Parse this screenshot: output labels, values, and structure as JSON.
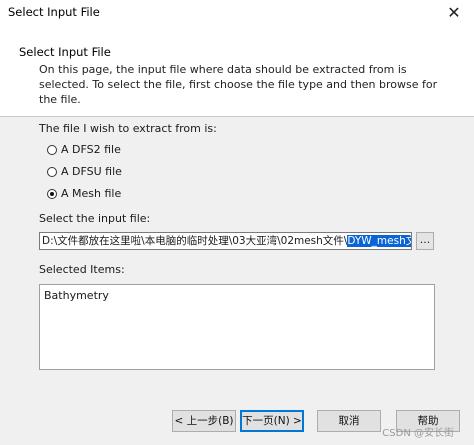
{
  "window": {
    "title": "Select Input File",
    "close_glyph": "✕"
  },
  "header": {
    "title": "Select Input File",
    "description": "On this page, the input file where data should be extracted from is selected. To select the file, first choose the file type and then browse for the file."
  },
  "extract": {
    "label": "The file I wish to extract from is:",
    "options": [
      {
        "label": "A DFS2 file",
        "selected": false
      },
      {
        "label": "A DFSU file",
        "selected": false
      },
      {
        "label": "A Mesh file",
        "selected": true
      }
    ]
  },
  "input_file": {
    "label": "Select the input file:",
    "path_prefix": "D:\\文件都放在这里啦\\本电脑的临时处理\\03大亚湾\\02mesh文件\\",
    "path_selected": "DYW_mesh文件.mesh",
    "browse_label": "..."
  },
  "selected_items": {
    "label": "Selected Items:",
    "items": [
      "Bathymetry"
    ]
  },
  "buttons": {
    "back": "< 上一步(B)",
    "next": "下一页(N) >",
    "cancel": "取消",
    "help": "帮助"
  },
  "watermark": "CSDN @安长街"
}
